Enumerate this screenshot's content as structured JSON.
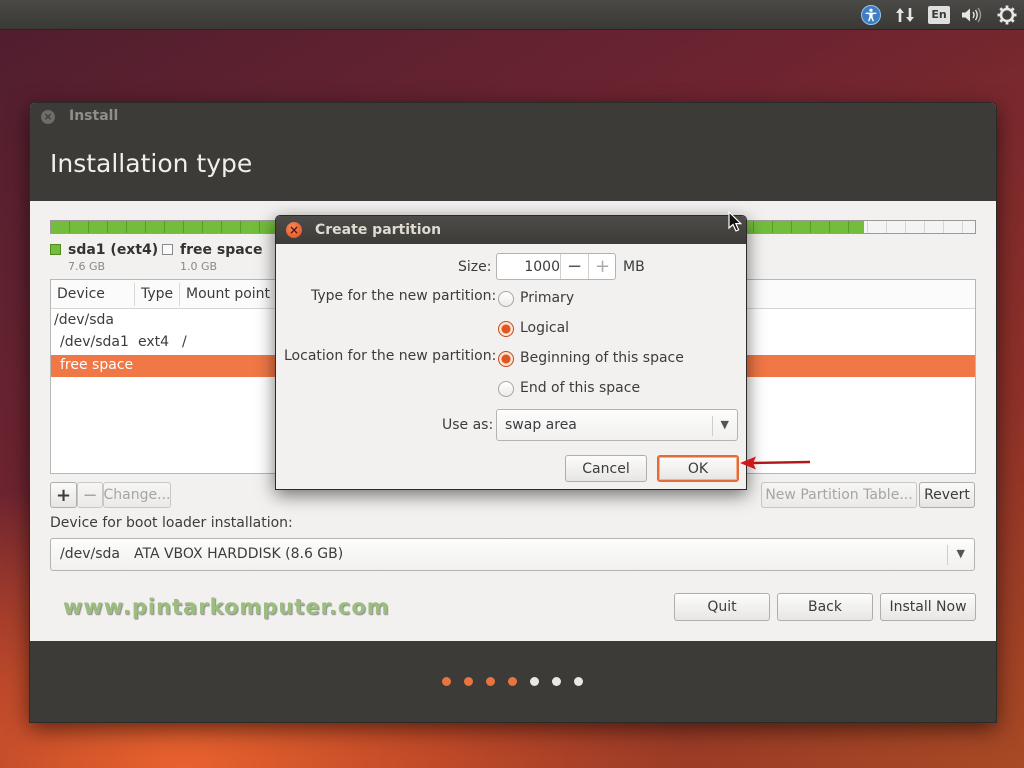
{
  "panel": {
    "keyboard_layout": "En",
    "icons": [
      "accessibility-icon",
      "network-icon",
      "keyboard-icon",
      "sound-icon",
      "settings-gear-icon"
    ]
  },
  "window": {
    "title": "Install",
    "page_title": "Installation type"
  },
  "disk": {
    "used_fraction": 0.88,
    "used_color": "#74bd3c",
    "legend": [
      {
        "label": "sda1 (ext4)",
        "size": "7.6 GB"
      },
      {
        "label": "free space",
        "size": "1.0 GB"
      }
    ]
  },
  "table": {
    "columns": [
      "Device",
      "Type",
      "Mount point"
    ],
    "rows": [
      {
        "device": "/dev/sda",
        "type": "",
        "mount": ""
      },
      {
        "device": "/dev/sda1",
        "type": "ext4",
        "mount": "/"
      },
      {
        "device": "free space",
        "type": "",
        "mount": "",
        "selected": true
      }
    ]
  },
  "toolbar": {
    "add_label": "+",
    "remove_label": "−",
    "change_label": "Change...",
    "new_table_label": "New Partition Table...",
    "revert_label": "Revert"
  },
  "bootloader": {
    "label": "Device for boot loader installation:",
    "device": "/dev/sda",
    "disk": "ATA VBOX HARDDISK (8.6 GB)"
  },
  "watermark": "www.pintarkomputer.com",
  "nav": {
    "quit_label": "Quit",
    "back_label": "Back",
    "install_label": "Install Now"
  },
  "progress": {
    "steps_done": 4,
    "steps_total": 7,
    "done_color": "#e9743f"
  },
  "dialog": {
    "title": "Create partition",
    "size_label": "Size:",
    "size_value": "1000",
    "size_unit": "MB",
    "type_label": "Type for the new partition:",
    "type_options": [
      {
        "label": "Primary",
        "checked": false
      },
      {
        "label": "Logical",
        "checked": true
      }
    ],
    "location_label": "Location for the new partition:",
    "location_options": [
      {
        "label": "Beginning of this space",
        "checked": true
      },
      {
        "label": "End of this space",
        "checked": false
      }
    ],
    "useas_label": "Use as:",
    "useas_value": "swap area",
    "cancel_label": "Cancel",
    "ok_label": "OK"
  }
}
